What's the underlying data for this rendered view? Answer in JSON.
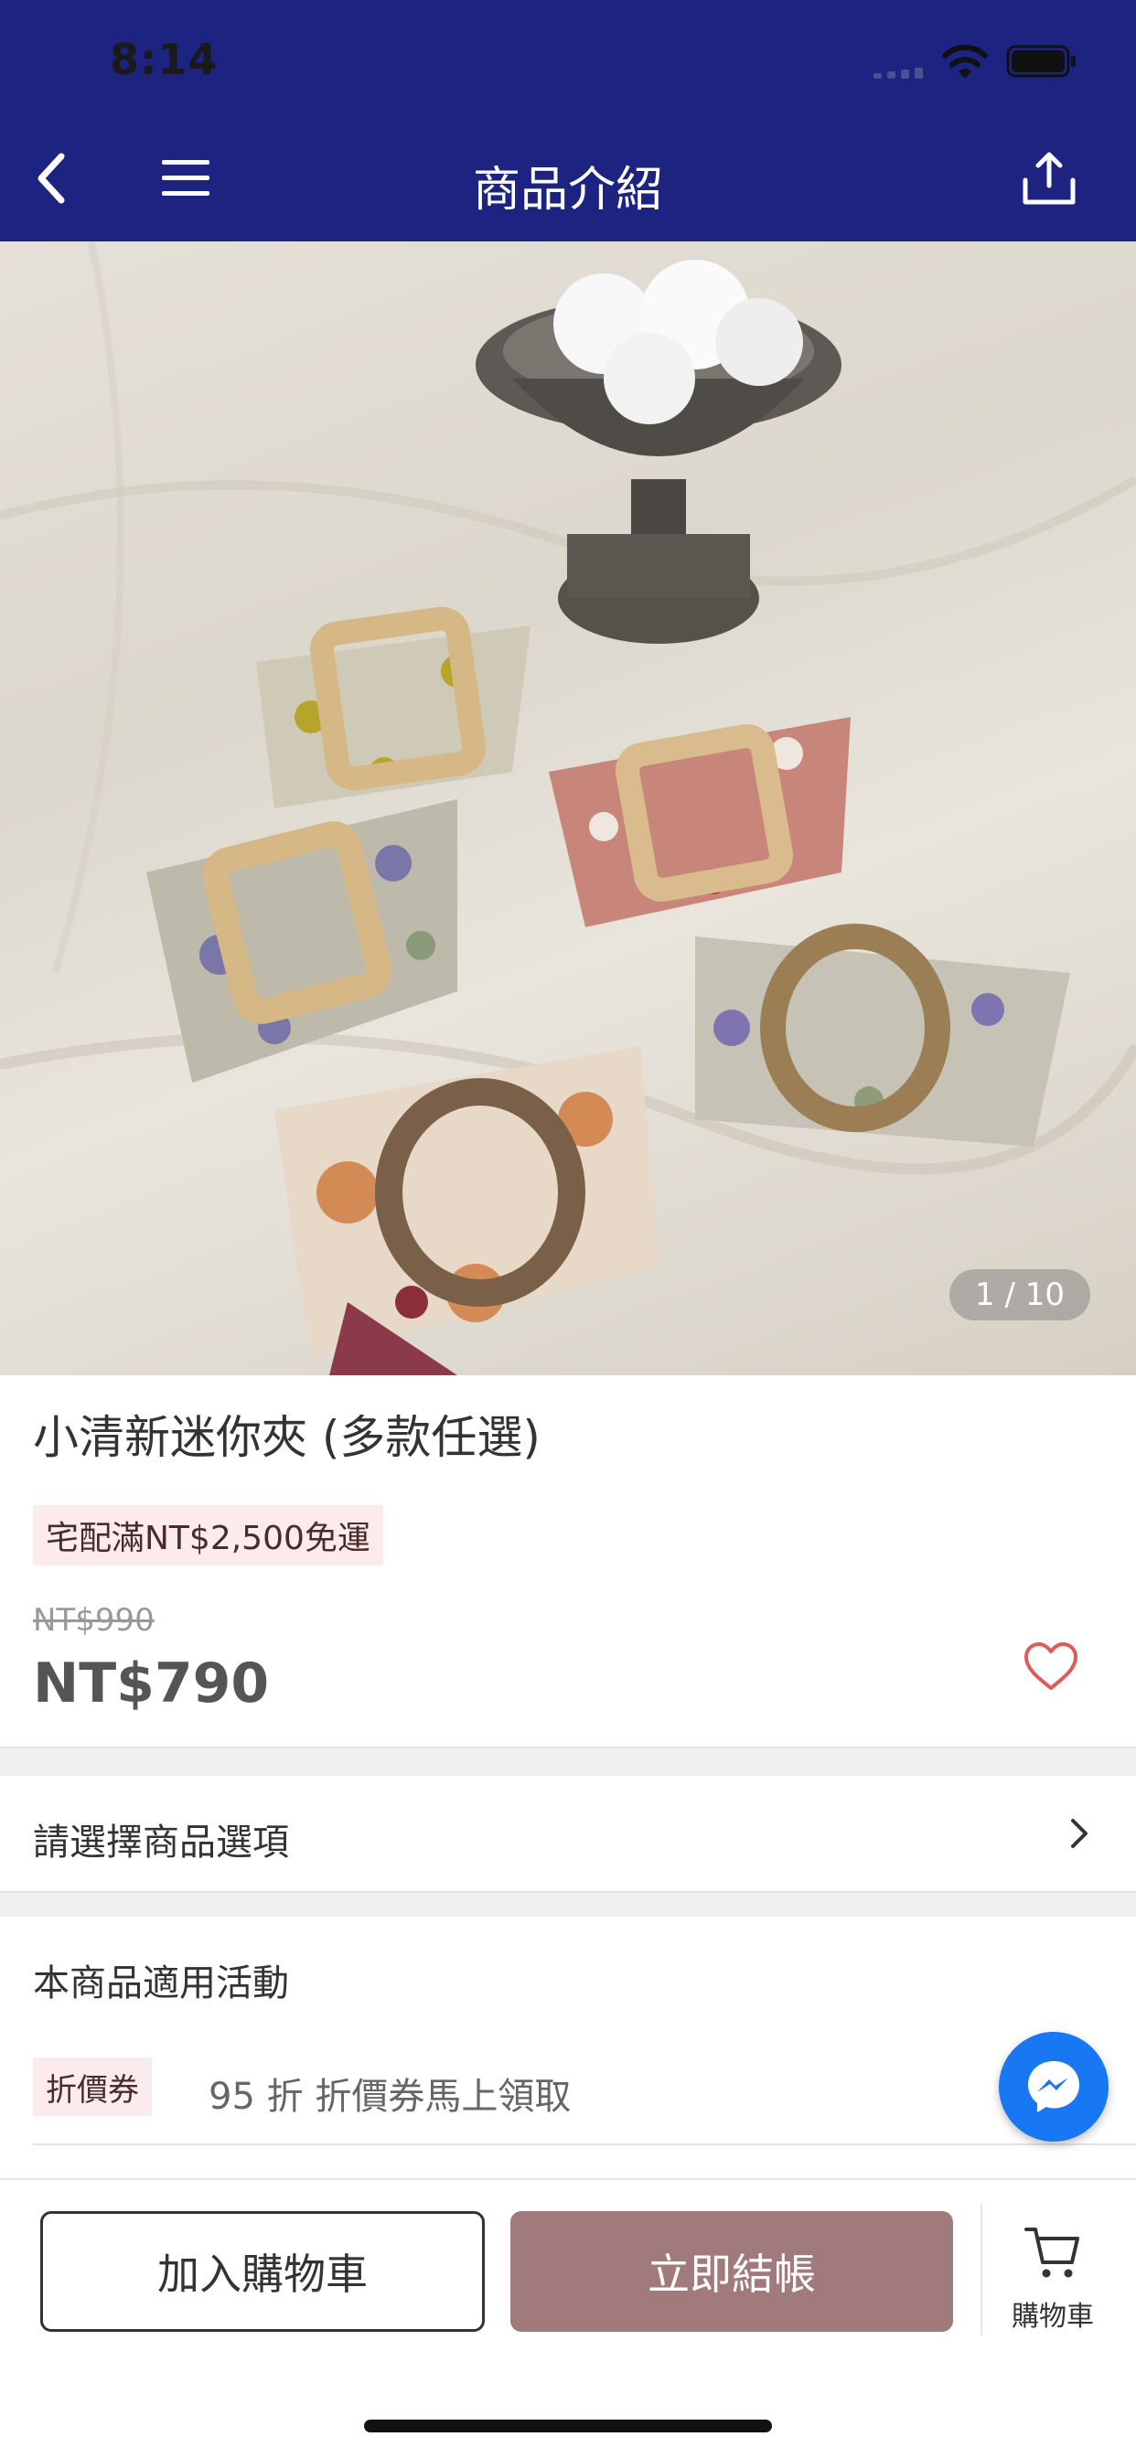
{
  "status_bar": {
    "time": "8:14"
  },
  "nav": {
    "title": "商品介紹",
    "icons": [
      "back-chevron-icon",
      "menu-icon",
      "share-icon"
    ]
  },
  "gallery": {
    "pager": "1 / 10"
  },
  "product": {
    "title": "小清新迷你夾 (多款任選)",
    "shipping_badge": "宅配滿NT$2,500免運",
    "original_price": "NT$990",
    "price": "NT$790"
  },
  "options": {
    "label": "請選擇商品選項"
  },
  "promotions": {
    "heading": "本商品適用活動",
    "items": [
      {
        "badge": "折價券",
        "text": "95 折 折價券馬上領取"
      }
    ]
  },
  "bottom_bar": {
    "add_to_cart": "加入購物車",
    "checkout": "立即結帳",
    "cart_label": "購物車"
  },
  "colors": {
    "nav_bg": "#1c2380",
    "checkout_bg": "#a17b7b",
    "badge_bg": "#fbeceb",
    "heart": "#e05a5a",
    "messenger": "#1877f2"
  }
}
